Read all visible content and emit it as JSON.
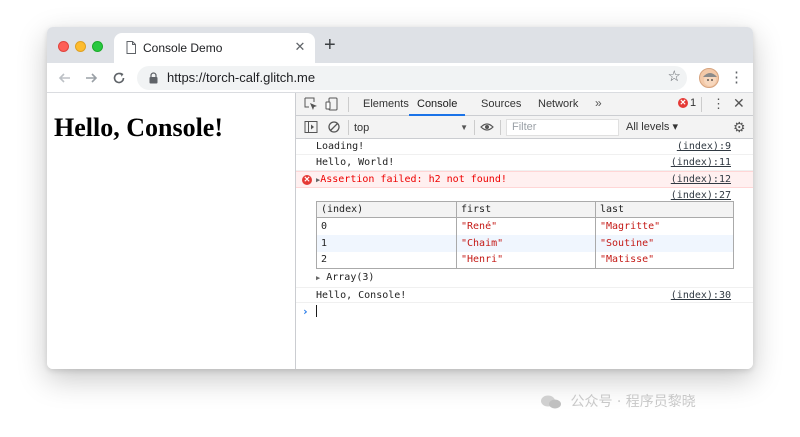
{
  "browser": {
    "tab_title": "Console Demo",
    "tab_close": "✕",
    "new_tab": "+",
    "url": "https://torch-calf.glitch.me",
    "icons": [
      "back-icon",
      "forward-icon",
      "reload-icon",
      "lock-icon",
      "star-icon",
      "avatar",
      "menu-icon"
    ]
  },
  "page": {
    "heading": "Hello, Console!"
  },
  "devtools": {
    "tabs": [
      {
        "label": "Elements"
      },
      {
        "label": "Console"
      },
      {
        "label": "Sources"
      },
      {
        "label": "Network"
      }
    ],
    "active_tab": "Console",
    "more_tabs": "»",
    "error_count": "1",
    "context": "top",
    "filter_placeholder": "Filter",
    "levels": "All levels ▾",
    "messages": [
      {
        "text": "Loading!",
        "source": "(index):9"
      },
      {
        "text": "Hello, World!",
        "source": "(index):11"
      },
      {
        "text": "Assertion failed: h2 not found!",
        "source": "(index):12",
        "level": "error"
      },
      {
        "text": "",
        "source": "(index):27"
      }
    ],
    "table": {
      "headers": [
        "(index)",
        "first",
        "last"
      ],
      "rows": [
        [
          "0",
          "\"René\"",
          "\"Magritte\""
        ],
        [
          "1",
          "\"Chaim\"",
          "\"Soutine\""
        ],
        [
          "2",
          "\"Henri\"",
          "\"Matisse\""
        ]
      ]
    },
    "array_summary": "Array(3)",
    "last_message": {
      "text": "Hello, Console!",
      "source": "(index):30"
    },
    "prompt": "›"
  },
  "watermark": "公众号 · 程序员黎晓",
  "colors": {
    "accent": "#1a73e8",
    "error": "#e53935",
    "string": "#c41a16"
  }
}
